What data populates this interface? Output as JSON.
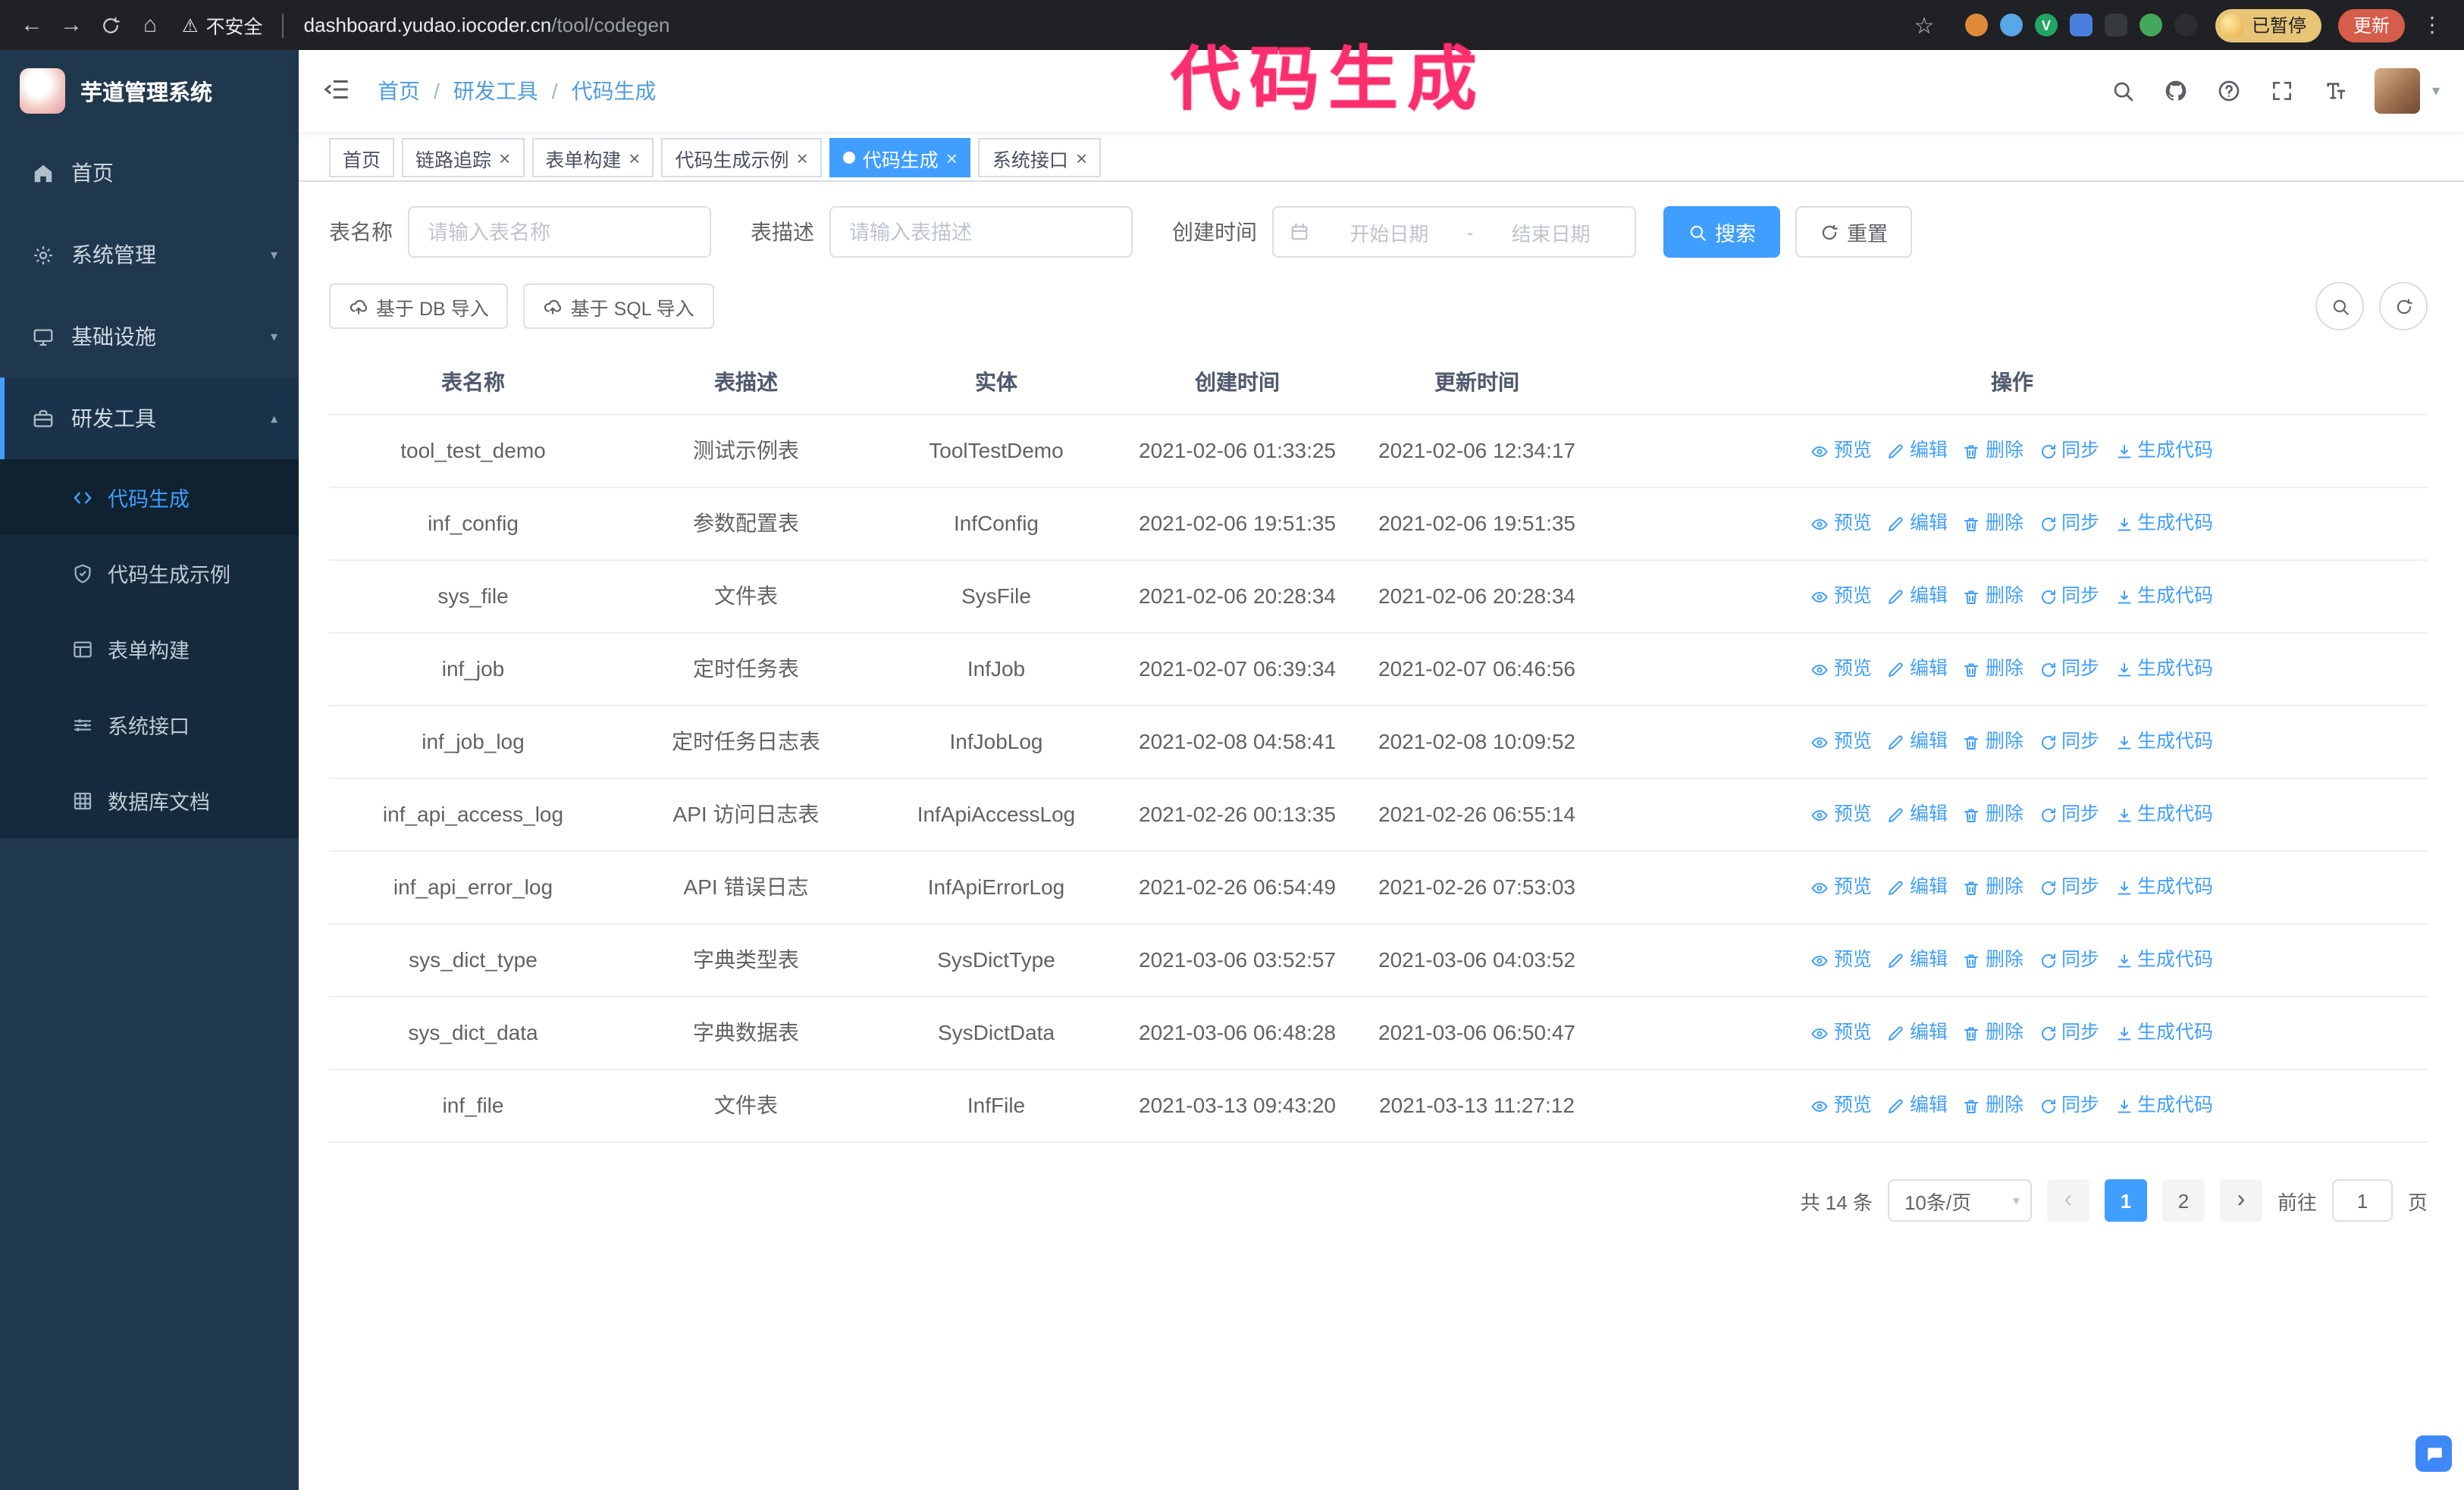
{
  "annotation": {
    "text": "代码生成",
    "color": "#fb2e6e"
  },
  "icons": {
    "back": "←",
    "forward": "→",
    "home": "⌂",
    "star": "☆",
    "warning": "⚠",
    "more": "⋮",
    "caret": "▾",
    "close": "×",
    "chevron_down": "▾",
    "chevron_up": "▴",
    "prev": "‹",
    "next": "›",
    "slash": "/"
  },
  "browser": {
    "security_label": "不安全",
    "url_host": "dashboard.yudao.iocoder.cn",
    "url_path": "/tool/codegen",
    "paused_badge": "已暂停",
    "update_button": "更新",
    "extensions": [
      {
        "key": "orange",
        "color": "#de8a3a",
        "shape": "circle"
      },
      {
        "key": "blue-drop",
        "color": "#58a7e8",
        "shape": "circle"
      },
      {
        "key": "green-check",
        "color": "#22a565",
        "shape": "circle",
        "glyph": "V"
      },
      {
        "key": "people",
        "color": "#4a7fe0",
        "shape": "square"
      },
      {
        "key": "dark",
        "color": "#35383c",
        "shape": "square"
      },
      {
        "key": "leaf",
        "color": "#43a85c",
        "shape": "circle"
      },
      {
        "key": "pin",
        "color": "#2b2d30",
        "shape": "circle"
      }
    ]
  },
  "sidebar": {
    "logo_title": "芋道管理系统",
    "menu": [
      {
        "key": "home",
        "label": "首页",
        "icon": "home-icon",
        "type": "item"
      },
      {
        "key": "system",
        "label": "系统管理",
        "icon": "gear-icon",
        "type": "group",
        "state": "collapsed"
      },
      {
        "key": "infra",
        "label": "基础设施",
        "icon": "infra-icon",
        "type": "group",
        "state": "collapsed"
      },
      {
        "key": "devtools",
        "label": "研发工具",
        "icon": "tools-icon",
        "type": "group",
        "state": "expanded"
      }
    ],
    "submenu": [
      {
        "key": "codegen",
        "label": "代码生成",
        "icon": "code-icon",
        "active": true
      },
      {
        "key": "codegen-example",
        "label": "代码生成示例",
        "icon": "shield-check-icon",
        "active": false
      },
      {
        "key": "form-builder",
        "label": "表单构建",
        "icon": "form-icon",
        "active": false
      },
      {
        "key": "system-api",
        "label": "系统接口",
        "icon": "sliders-icon",
        "active": false
      },
      {
        "key": "db-doc",
        "label": "数据库文档",
        "icon": "grid-icon",
        "active": false
      }
    ]
  },
  "header": {
    "breadcrumb": [
      "首页",
      "研发工具",
      "代码生成"
    ]
  },
  "tabs": [
    {
      "key": "home",
      "label": "首页",
      "closable": false,
      "active": false
    },
    {
      "key": "trace",
      "label": "链路追踪",
      "closable": true,
      "active": false
    },
    {
      "key": "form-builder",
      "label": "表单构建",
      "closable": true,
      "active": false
    },
    {
      "key": "codegen-example",
      "label": "代码生成示例",
      "closable": true,
      "active": false
    },
    {
      "key": "codegen",
      "label": "代码生成",
      "closable": true,
      "active": true
    },
    {
      "key": "system-api",
      "label": "系统接口",
      "closable": true,
      "active": false
    }
  ],
  "filters": {
    "table_name_label": "表名称",
    "table_name_placeholder": "请输入表名称",
    "table_desc_label": "表描述",
    "table_desc_placeholder": "请输入表描述",
    "create_time_label": "创建时间",
    "date_start_placeholder": "开始日期",
    "date_separator": "-",
    "date_end_placeholder": "结束日期",
    "search_button": "搜索",
    "reset_button": "重置"
  },
  "toolbar": {
    "import_db": "基于 DB 导入",
    "import_sql": "基于 SQL 导入"
  },
  "table": {
    "columns": [
      "表名称",
      "表描述",
      "实体",
      "创建时间",
      "更新时间",
      "操作"
    ],
    "actions": [
      {
        "key": "preview",
        "label": "预览",
        "icon": "eye-icon"
      },
      {
        "key": "edit",
        "label": "编辑",
        "icon": "edit-icon"
      },
      {
        "key": "delete",
        "label": "删除",
        "icon": "delete-icon"
      },
      {
        "key": "sync",
        "label": "同步",
        "icon": "sync-icon"
      },
      {
        "key": "generate",
        "label": "生成代码",
        "icon": "download-icon"
      }
    ],
    "rows": [
      {
        "name": "tool_test_demo",
        "desc": "测试示例表",
        "entity": "ToolTestDemo",
        "created": "2021-02-06 01:33:25",
        "updated": "2021-02-06 12:34:17"
      },
      {
        "name": "inf_config",
        "desc": "参数配置表",
        "entity": "InfConfig",
        "created": "2021-02-06 19:51:35",
        "updated": "2021-02-06 19:51:35"
      },
      {
        "name": "sys_file",
        "desc": "文件表",
        "entity": "SysFile",
        "created": "2021-02-06 20:28:34",
        "updated": "2021-02-06 20:28:34"
      },
      {
        "name": "inf_job",
        "desc": "定时任务表",
        "entity": "InfJob",
        "created": "2021-02-07 06:39:34",
        "updated": "2021-02-07 06:46:56"
      },
      {
        "name": "inf_job_log",
        "desc": "定时任务日志表",
        "entity": "InfJobLog",
        "created": "2021-02-08 04:58:41",
        "updated": "2021-02-08 10:09:52"
      },
      {
        "name": "inf_api_access_log",
        "desc": "API 访问日志表",
        "entity": "InfApiAccessLog",
        "created": "2021-02-26 00:13:35",
        "updated": "2021-02-26 06:55:14"
      },
      {
        "name": "inf_api_error_log",
        "desc": "API 错误日志",
        "entity": "InfApiErrorLog",
        "created": "2021-02-26 06:54:49",
        "updated": "2021-02-26 07:53:03"
      },
      {
        "name": "sys_dict_type",
        "desc": "字典类型表",
        "entity": "SysDictType",
        "created": "2021-03-06 03:52:57",
        "updated": "2021-03-06 04:03:52"
      },
      {
        "name": "sys_dict_data",
        "desc": "字典数据表",
        "entity": "SysDictData",
        "created": "2021-03-06 06:48:28",
        "updated": "2021-03-06 06:50:47"
      },
      {
        "name": "inf_file",
        "desc": "文件表",
        "entity": "InfFile",
        "created": "2021-03-13 09:43:20",
        "updated": "2021-03-13 11:27:12"
      }
    ]
  },
  "pagination": {
    "total_text": "共 14 条",
    "page_size": "10条/页",
    "pages": [
      "1",
      "2"
    ],
    "active_page": "1",
    "goto_prefix": "前往",
    "goto_value": "1",
    "goto_suffix": "页"
  },
  "colors": {
    "primary": "#409eff",
    "sidebar": "#20384e",
    "annotation": "#fb2e6e"
  }
}
